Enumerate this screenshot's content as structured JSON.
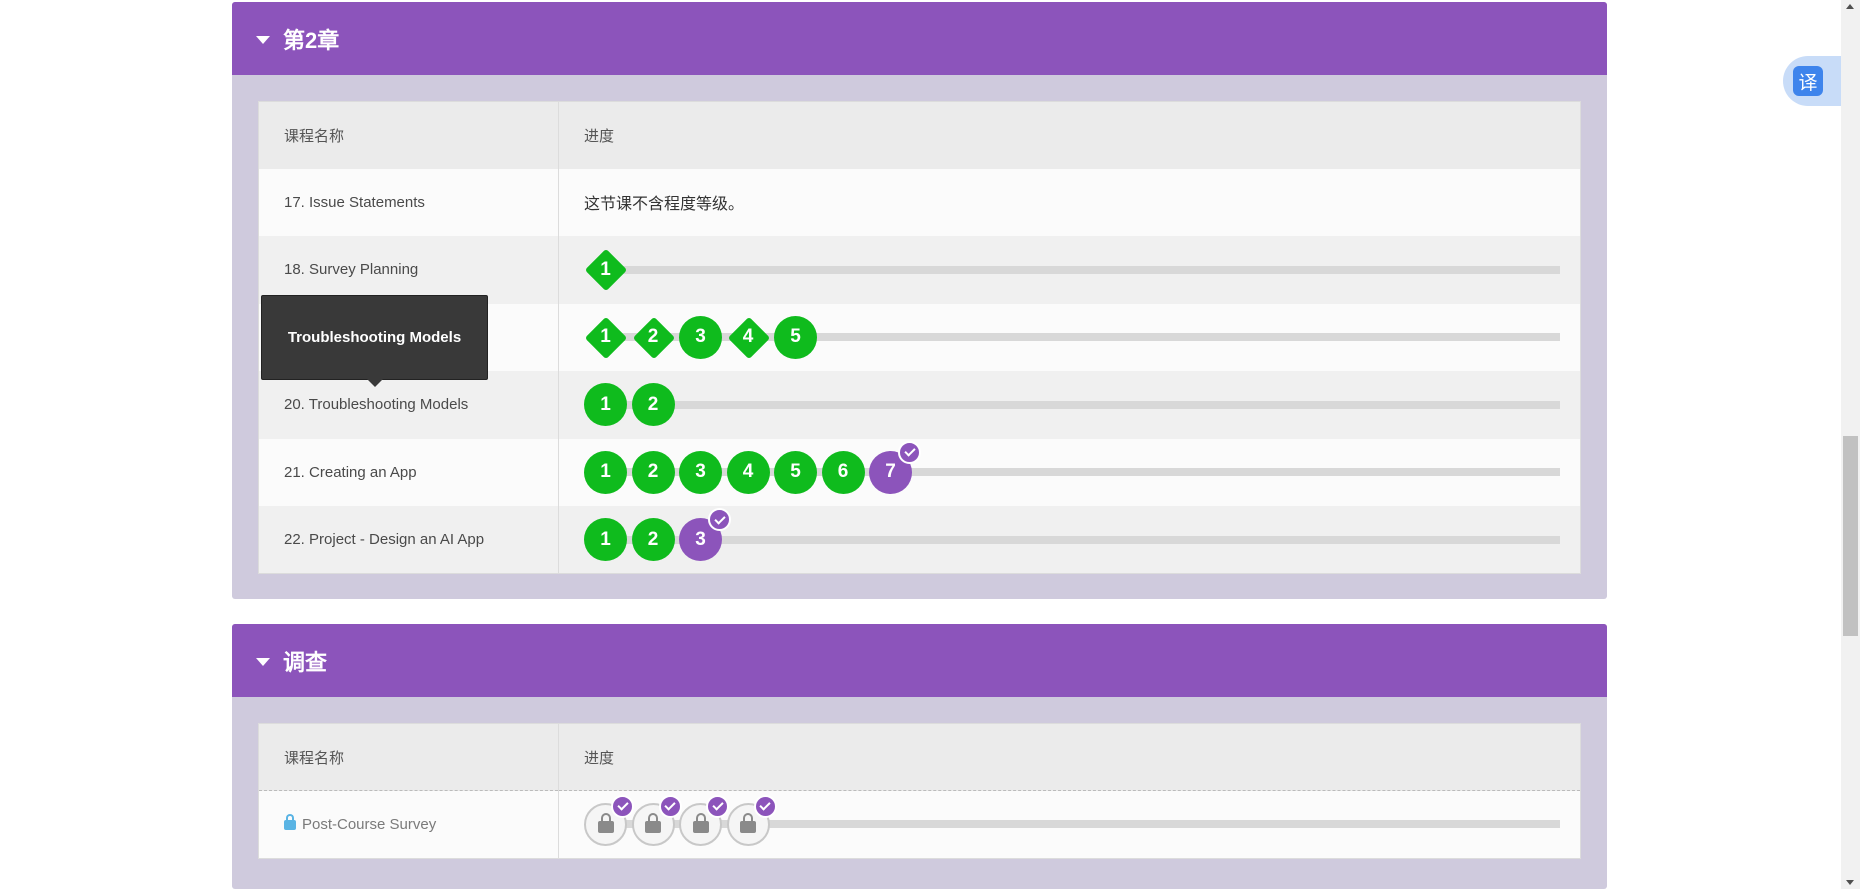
{
  "chapter2": {
    "title": "第2章",
    "header_name": "课程名称",
    "header_progress": "进度",
    "lessons": [
      {
        "name": "17. Issue Statements",
        "note": "这节课不含程度等级。"
      },
      {
        "name": "18. Survey Planning",
        "levels": [
          "1"
        ]
      },
      {
        "name": "",
        "levels": [
          "1",
          "2",
          "3",
          "4",
          "5"
        ]
      },
      {
        "name": "20. Troubleshooting Models",
        "levels": [
          "1",
          "2"
        ]
      },
      {
        "name": "21. Creating an App",
        "levels": [
          "1",
          "2",
          "3",
          "4",
          "5",
          "6",
          "7"
        ]
      },
      {
        "name": "22. Project - Design an AI App",
        "levels": [
          "1",
          "2",
          "3"
        ]
      }
    ]
  },
  "tooltip": {
    "text": "Troubleshooting Models"
  },
  "survey": {
    "title": "调查",
    "header_name": "课程名称",
    "header_progress": "进度",
    "lesson_name": "Post-Course Survey"
  },
  "translate": {
    "label": "译"
  },
  "colors": {
    "accent": "#8c54bb",
    "complete": "#0fbb1d",
    "panel_bg": "#cfcadd"
  }
}
